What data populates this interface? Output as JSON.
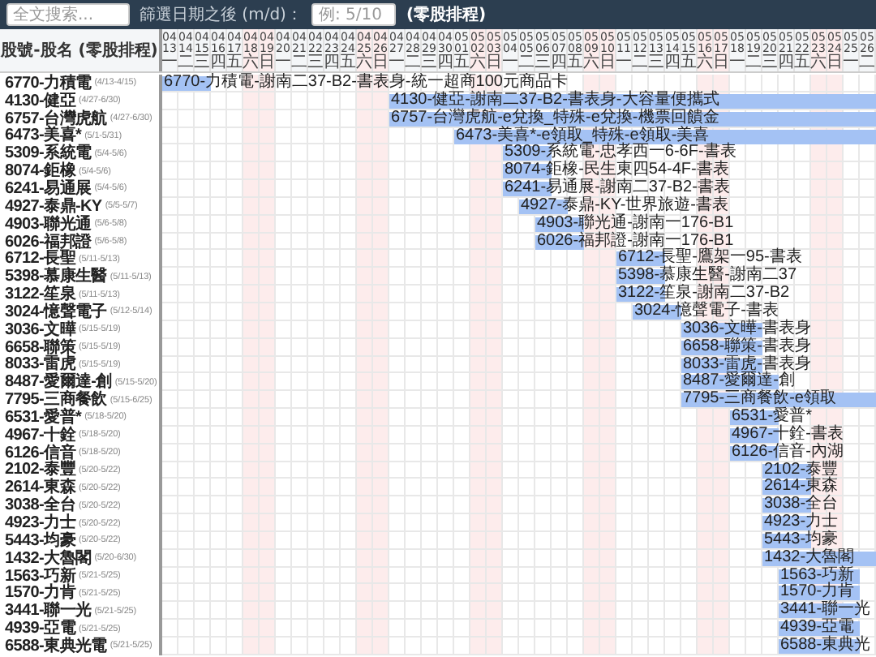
{
  "toolbar": {
    "search": {
      "placeholder": "全文搜索..."
    },
    "date_filter": {
      "label": "篩選日期之後 (m/d)：",
      "placeholder": "例: 5/10"
    },
    "title": "(零股排程)"
  },
  "schedule": {
    "header": "股號-股名 (零股排程)",
    "dates": [
      {
        "month": "04",
        "day": "13",
        "weekday": "一",
        "weekend": false
      },
      {
        "month": "04",
        "day": "14",
        "weekday": "二",
        "weekend": false
      },
      {
        "month": "04",
        "day": "15",
        "weekday": "三",
        "weekend": false
      },
      {
        "month": "04",
        "day": "16",
        "weekday": "四",
        "weekend": false
      },
      {
        "month": "04",
        "day": "17",
        "weekday": "五",
        "weekend": false
      },
      {
        "month": "04",
        "day": "18",
        "weekday": "六",
        "weekend": true
      },
      {
        "month": "04",
        "day": "19",
        "weekday": "日",
        "weekend": true
      },
      {
        "month": "04",
        "day": "20",
        "weekday": "一",
        "weekend": false
      },
      {
        "month": "04",
        "day": "21",
        "weekday": "二",
        "weekend": false
      },
      {
        "month": "04",
        "day": "22",
        "weekday": "三",
        "weekend": false
      },
      {
        "month": "04",
        "day": "23",
        "weekday": "四",
        "weekend": false
      },
      {
        "month": "04",
        "day": "24",
        "weekday": "五",
        "weekend": false
      },
      {
        "month": "04",
        "day": "25",
        "weekday": "六",
        "weekend": true
      },
      {
        "month": "04",
        "day": "26",
        "weekday": "日",
        "weekend": true
      },
      {
        "month": "04",
        "day": "27",
        "weekday": "一",
        "weekend": false
      },
      {
        "month": "04",
        "day": "28",
        "weekday": "二",
        "weekend": false
      },
      {
        "month": "04",
        "day": "29",
        "weekday": "三",
        "weekend": false
      },
      {
        "month": "04",
        "day": "30",
        "weekday": "四",
        "weekend": false
      },
      {
        "month": "05",
        "day": "01",
        "weekday": "五",
        "weekend": false
      },
      {
        "month": "05",
        "day": "02",
        "weekday": "六",
        "weekend": true
      },
      {
        "month": "05",
        "day": "03",
        "weekday": "日",
        "weekend": true
      },
      {
        "month": "05",
        "day": "04",
        "weekday": "一",
        "weekend": false
      },
      {
        "month": "05",
        "day": "05",
        "weekday": "二",
        "weekend": false
      },
      {
        "month": "05",
        "day": "06",
        "weekday": "三",
        "weekend": false
      },
      {
        "month": "05",
        "day": "07",
        "weekday": "四",
        "weekend": false
      },
      {
        "month": "05",
        "day": "08",
        "weekday": "五",
        "weekend": false
      },
      {
        "month": "05",
        "day": "09",
        "weekday": "六",
        "weekend": true
      },
      {
        "month": "05",
        "day": "10",
        "weekday": "日",
        "weekend": true
      },
      {
        "month": "05",
        "day": "11",
        "weekday": "一",
        "weekend": false
      },
      {
        "month": "05",
        "day": "12",
        "weekday": "二",
        "weekend": false
      },
      {
        "month": "05",
        "day": "13",
        "weekday": "三",
        "weekend": false
      },
      {
        "month": "05",
        "day": "14",
        "weekday": "四",
        "weekend": false
      },
      {
        "month": "05",
        "day": "15",
        "weekday": "五",
        "weekend": false
      },
      {
        "month": "05",
        "day": "16",
        "weekday": "六",
        "weekend": true
      },
      {
        "month": "05",
        "day": "17",
        "weekday": "日",
        "weekend": true
      },
      {
        "month": "05",
        "day": "18",
        "weekday": "一",
        "weekend": false
      },
      {
        "month": "05",
        "day": "19",
        "weekday": "二",
        "weekend": false
      },
      {
        "month": "05",
        "day": "20",
        "weekday": "三",
        "weekend": false
      },
      {
        "month": "05",
        "day": "21",
        "weekday": "四",
        "weekend": false
      },
      {
        "month": "05",
        "day": "22",
        "weekday": "五",
        "weekend": false
      },
      {
        "month": "05",
        "day": "23",
        "weekday": "六",
        "weekend": true
      },
      {
        "month": "05",
        "day": "24",
        "weekday": "日",
        "weekend": true
      },
      {
        "month": "05",
        "day": "25",
        "weekday": "一",
        "weekend": false
      },
      {
        "month": "05",
        "day": "26",
        "weekday": "二",
        "weekend": false
      }
    ],
    "rows": [
      {
        "name": "6770-力積電",
        "range": "(4/13-4/15)",
        "bar_label": "6770-力積電-謝南二37-B2-書表身-統一超商100元商品卡"
      },
      {
        "name": "4130-健亞",
        "range": "(4/27-6/30)",
        "bar_label": "4130-健亞-謝南二37-B2-書表身-大容量便攜式"
      },
      {
        "name": "6757-台灣虎航",
        "range": "(4/27-6/30)",
        "bar_label": "6757-台灣虎航-e兌換_特殊-e兌換-機票回饋金"
      },
      {
        "name": "6473-美喜*",
        "range": "(5/1-5/31)",
        "bar_label": "6473-美喜*-e領取_特殊-e領取-美喜"
      },
      {
        "name": "5309-系統電",
        "range": "(5/4-5/6)",
        "bar_label": "5309-系統電-忠孝西一6-6F-書表"
      },
      {
        "name": "8074-鉅橡",
        "range": "(5/4-5/6)",
        "bar_label": "8074-鉅橡-民生東四54-4F-書表"
      },
      {
        "name": "6241-易通展",
        "range": "(5/4-5/6)",
        "bar_label": "6241-易通展-謝南二37-B2-書表"
      },
      {
        "name": "4927-泰鼎-KY",
        "range": "(5/5-5/7)",
        "bar_label": "4927-泰鼎-KY-世界旅遊-書表"
      },
      {
        "name": "4903-聯光通",
        "range": "(5/6-5/8)",
        "bar_label": "4903-聯光通-謝南一176-B1"
      },
      {
        "name": "6026-福邦證",
        "range": "(5/6-5/8)",
        "bar_label": "6026-福邦證-謝南一176-B1"
      },
      {
        "name": "6712-長聖",
        "range": "(5/11-5/13)",
        "bar_label": "6712-長聖-鷹架一95-書表"
      },
      {
        "name": "5398-慕康生醫",
        "range": "(5/11-5/13)",
        "bar_label": "5398-慕康生醫-謝南二37"
      },
      {
        "name": "3122-笙泉",
        "range": "(5/11-5/13)",
        "bar_label": "3122-笙泉-謝南二37-B2"
      },
      {
        "name": "3024-憶聲電子",
        "range": "(5/12-5/14)",
        "bar_label": "3024-憶聲電子-書表"
      },
      {
        "name": "3036-文曄",
        "range": "(5/15-5/19)",
        "bar_label": "3036-文曄-書表身"
      },
      {
        "name": "6658-聯策",
        "range": "(5/15-5/19)",
        "bar_label": "6658-聯策-書表身"
      },
      {
        "name": "8033-雷虎",
        "range": "(5/15-5/19)",
        "bar_label": "8033-雷虎-書表身"
      },
      {
        "name": "8487-愛爾達-創",
        "range": "(5/15-5/20)",
        "bar_label": "8487-愛爾達-創"
      },
      {
        "name": "7795-三商餐飲",
        "range": "(5/15-6/25)",
        "bar_label": "7795-三商餐飲-e領取"
      },
      {
        "name": "6531-愛普*",
        "range": "(5/18-5/20)",
        "bar_label": "6531-愛普*"
      },
      {
        "name": "4967-十銓",
        "range": "(5/18-5/20)",
        "bar_label": "4967-十銓-書表"
      },
      {
        "name": "6126-信音",
        "range": "(5/18-5/20)",
        "bar_label": "6126-信音-內湖"
      },
      {
        "name": "2102-泰豐",
        "range": "(5/20-5/22)",
        "bar_label": "2102-泰豐"
      },
      {
        "name": "2614-東森",
        "range": "(5/20-5/22)",
        "bar_label": "2614-東森"
      },
      {
        "name": "3038-全台",
        "range": "(5/20-5/22)",
        "bar_label": "3038-全台"
      },
      {
        "name": "4923-力士",
        "range": "(5/20-5/22)",
        "bar_label": "4923-力士"
      },
      {
        "name": "5443-均豪",
        "range": "(5/20-5/22)",
        "bar_label": "5443-均豪"
      },
      {
        "name": "1432-大魯閣",
        "range": "(5/20-6/30)",
        "bar_label": "1432-大魯閣"
      },
      {
        "name": "1563-巧新",
        "range": "(5/21-5/25)",
        "bar_label": "1563-巧新"
      },
      {
        "name": "1570-力肯",
        "range": "(5/21-5/25)",
        "bar_label": "1570-力肯"
      },
      {
        "name": "3441-聯一光",
        "range": "(5/21-5/25)",
        "bar_label": "3441-聯一光"
      },
      {
        "name": "4939-亞電",
        "range": "(5/21-5/25)",
        "bar_label": "4939-亞電"
      },
      {
        "name": "6588-東典光電",
        "range": "(5/21-5/25)",
        "bar_label": "6588-東典光"
      }
    ]
  }
}
